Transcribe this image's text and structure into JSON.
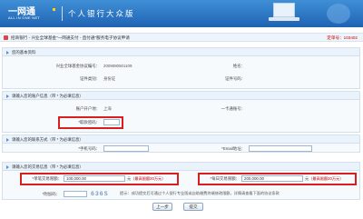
{
  "header": {
    "logo_cn": "一网通",
    "logo_en": "ALL IN ONE NET",
    "title": "个人银行大众版"
  },
  "breadcrumb": {
    "text": "招商银行 - 兴业全球基金\"一网通支付 - 直付通\"服务电子协议申请",
    "order_label": "定单号：",
    "order_no": "103402"
  },
  "sections": {
    "basic_title": "您的基本资料",
    "account_title": "请输入您的账户信息",
    "account_note": "（带 * 为必填信息）",
    "contact_title": "请输入您的联系方式",
    "contact_note": "（带 * 为必填信息）",
    "trade_title": "请输入您的交易信息",
    "trade_note": "（带 * 为必填信息）",
    "star": "*"
  },
  "basic": {
    "agreement_label": "兴业全球基金协议编号：",
    "agreement_value": "2009080501109",
    "name_label": "姓名：",
    "name_value": "",
    "id_type_label": "证件类别：",
    "id_type_value": "身份证",
    "id_no_label": "证件号码：",
    "id_no_value": ""
  },
  "account": {
    "city_label": "账户开户地：",
    "city_value": "上海",
    "card_label": "一卡通账号：",
    "card_value": "",
    "password_label": "*取款密码：",
    "password_value": ""
  },
  "contact": {
    "mobile_label": "*手机号码：",
    "mobile_value": "",
    "email_label": "*Email地址：",
    "email_value": ""
  },
  "trade": {
    "single_label": "*单笔交易限额：",
    "single_value": "100,000.00",
    "single_unit": "元",
    "single_note_prefix": "（",
    "single_note": "最高限额20万元",
    "single_note_suffix": "）",
    "daily_label": "*每日交易限额：",
    "daily_value": "200,000.00",
    "daily_unit": "元",
    "daily_note_prefix": "（",
    "daily_note": "最高限额20万元",
    "daily_note_suffix": "）",
    "captcha_label": "*附加码：",
    "captcha_value": "",
    "captcha_image": "636S",
    "hint": "提示：成功提交后可通过个人银行专业版或自助缴费终端修改限额，详情请查看下面的协议条款"
  },
  "buttons": {
    "prev": "上一步",
    "next": "提交"
  },
  "colors": {
    "header_blue": "#1f63b3",
    "highlight_red": "#d81e1e",
    "required_red": "#cc0000"
  }
}
